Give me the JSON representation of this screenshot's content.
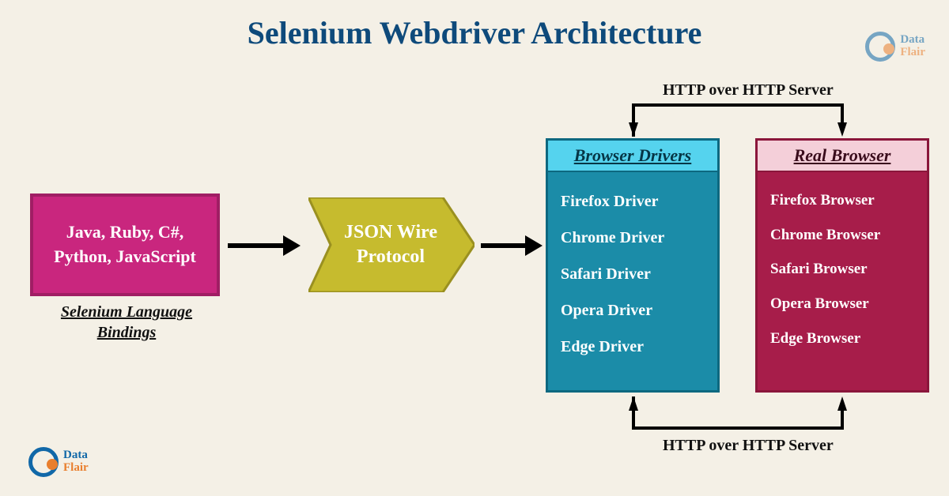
{
  "title": "Selenium Webdriver Architecture",
  "lang_box": "Java, Ruby, C#, Python, JavaScript",
  "lang_caption": "Selenium Language Bindings",
  "json_wire": "JSON Wire Protocol",
  "drivers": {
    "header": "Browser Drivers",
    "items": [
      "Firefox Driver",
      "Chrome Driver",
      "Safari Driver",
      "Opera Driver",
      "Edge Driver"
    ]
  },
  "browsers": {
    "header": "Real Browser",
    "items": [
      "Firefox Browser",
      "Chrome Browser",
      "Safari Browser",
      "Opera Browser",
      "Edge Browser"
    ]
  },
  "http_label_top": "HTTP over HTTP Server",
  "http_label_bottom": "HTTP over HTTP Server",
  "logo": {
    "line1": "Data",
    "line2": "Flair"
  }
}
